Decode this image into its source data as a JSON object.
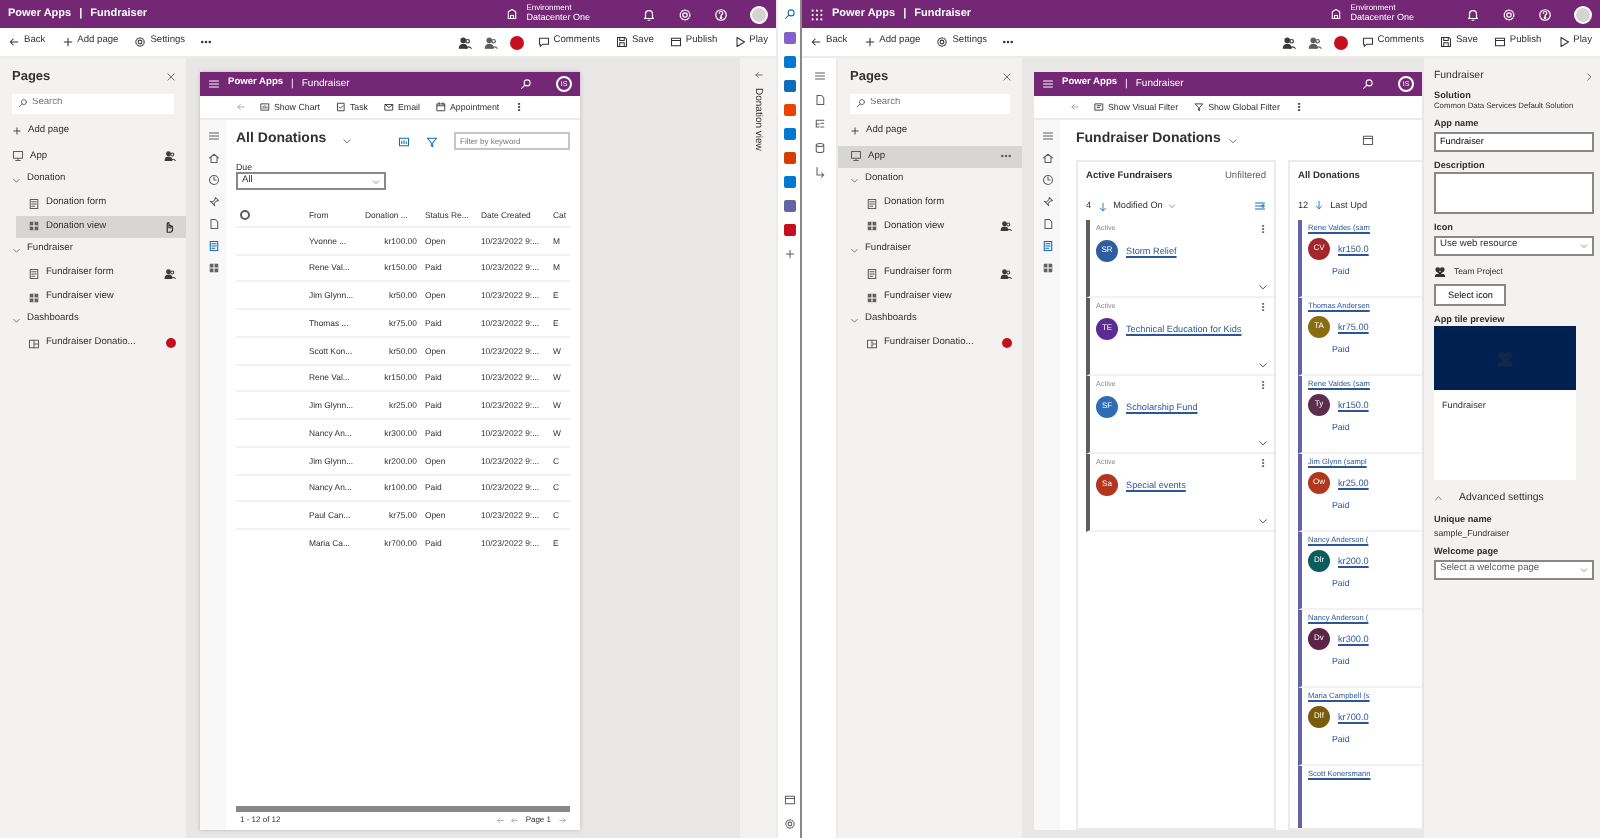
{
  "left_screen": {
    "topbar": {
      "app": "Power Apps",
      "separator": "|",
      "title": "Fundraiser",
      "environment_label": "Environment",
      "environment": "Datacenter One"
    },
    "command_bar": {
      "left": [
        {
          "kind": "back",
          "label": "Back"
        },
        {
          "kind": "add",
          "label": "Add page"
        },
        {
          "kind": "settings",
          "label": "Settings"
        },
        {
          "kind": "more"
        }
      ],
      "right": [
        {
          "kind": "comments",
          "label": "Comments"
        },
        {
          "kind": "save",
          "label": "Save"
        },
        {
          "kind": "publish",
          "label": "Publish"
        },
        {
          "kind": "play",
          "label": "Play"
        }
      ]
    },
    "pages": {
      "title": "Pages",
      "search_placeholder": "Search",
      "add_label": "Add page",
      "tree": [
        {
          "label": "App",
          "kind": "app",
          "selected": false,
          "shared": true
        },
        {
          "label": "Donation",
          "kind": "group",
          "selected": false,
          "expanded": true,
          "children": [
            {
              "label": "Donation form",
              "kind": "form",
              "selected": false
            },
            {
              "label": "Donation view",
              "kind": "view",
              "selected": true,
              "hovered": true
            }
          ]
        },
        {
          "label": "Fundraiser",
          "kind": "group",
          "selected": false,
          "expanded": true,
          "children": [
            {
              "label": "Fundraiser form",
              "kind": "form",
              "selected": false,
              "shared": true
            },
            {
              "label": "Fundraiser view",
              "kind": "view",
              "selected": false
            }
          ]
        },
        {
          "label": "Dashboards",
          "kind": "group",
          "selected": false,
          "expanded": true,
          "children": [
            {
              "label": "Fundraiser Donatio...",
              "kind": "dashboard",
              "selected": false,
              "alert": true
            }
          ]
        }
      ]
    },
    "preview": {
      "header": {
        "app": "Power Apps",
        "title": "Fundraiser",
        "avatar": "IS"
      },
      "select_all_checked": false,
      "commands": [
        {
          "kind": "chart",
          "label": "Show Chart"
        },
        {
          "kind": "task",
          "label": "Task"
        },
        {
          "kind": "email",
          "label": "Email"
        },
        {
          "kind": "appointment",
          "label": "Appointment"
        }
      ],
      "view_title": "All Donations",
      "filter_placeholder": "Filter by keyword",
      "filter_label": "Due",
      "filter_value": "All",
      "columns": [
        "From",
        "Donation ...",
        "Status Re...",
        "Date Created",
        "Cat"
      ],
      "rows": [
        [
          "Yvonne ...",
          "kr100.00",
          "Open",
          "10/23/2022 9:...",
          "M"
        ],
        [
          "Rene Val...",
          "kr150.00",
          "Paid",
          "10/23/2022 9:...",
          "M"
        ],
        [
          "Jim Glynn...",
          "kr50.00",
          "Open",
          "10/23/2022 9:...",
          "E"
        ],
        [
          "Thomas ...",
          "kr75.00",
          "Paid",
          "10/23/2022 9:...",
          "E"
        ],
        [
          "Scott Kon...",
          "kr50.00",
          "Open",
          "10/23/2022 9:...",
          "W"
        ],
        [
          "Rene Val...",
          "kr150.00",
          "Paid",
          "10/23/2022 9:...",
          "W"
        ],
        [
          "Jim Glynn...",
          "kr25.00",
          "Paid",
          "10/23/2022 9:...",
          "W"
        ],
        [
          "Nancy An...",
          "kr300.00",
          "Paid",
          "10/23/2022 9:...",
          "W"
        ],
        [
          "Jim Glynn...",
          "kr200.00",
          "Open",
          "10/23/2022 9:...",
          "C"
        ],
        [
          "Nancy An...",
          "kr100.00",
          "Paid",
          "10/23/2022 9:...",
          "C"
        ],
        [
          "Paul Can...",
          "kr75.00",
          "Open",
          "10/23/2022 9:...",
          "C"
        ],
        [
          "Maria Ca...",
          "kr700.00",
          "Paid",
          "10/23/2022 9:...",
          "E"
        ]
      ],
      "footer": {
        "count": "1 - 12 of 12",
        "page": "Page 1"
      }
    },
    "collapsed_panel": "Donation view"
  },
  "right_screen": {
    "topbar": {
      "app": "Power Apps",
      "separator": "|",
      "title": "Fundraiser",
      "environment_label": "Environment",
      "environment": "Datacenter One"
    },
    "command_bar": {
      "left": [
        {
          "kind": "back",
          "label": "Back"
        },
        {
          "kind": "add",
          "label": "Add page"
        },
        {
          "kind": "settings",
          "label": "Settings"
        },
        {
          "kind": "more"
        }
      ],
      "right": [
        {
          "kind": "comments",
          "label": "Comments"
        },
        {
          "kind": "save",
          "label": "Save"
        },
        {
          "kind": "publish",
          "label": "Publish"
        },
        {
          "kind": "play",
          "label": "Play"
        }
      ]
    },
    "pages": {
      "title": "Pages",
      "search_placeholder": "Search",
      "add_label": "Add page",
      "tree": [
        {
          "label": "App",
          "kind": "app",
          "selected": true,
          "has_menu": true
        },
        {
          "label": "Donation",
          "kind": "group",
          "selected": false,
          "expanded": true,
          "children": [
            {
              "label": "Donation form",
              "kind": "form",
              "selected": false
            },
            {
              "label": "Donation view",
              "kind": "view",
              "selected": false,
              "shared": true
            }
          ]
        },
        {
          "label": "Fundraiser",
          "kind": "group",
          "selected": false,
          "expanded": true,
          "children": [
            {
              "label": "Fundraiser form",
              "kind": "form",
              "selected": false,
              "shared": true
            },
            {
              "label": "Fundraiser view",
              "kind": "view",
              "selected": false
            }
          ]
        },
        {
          "label": "Dashboards",
          "kind": "group",
          "selected": false,
          "expanded": true,
          "children": [
            {
              "label": "Fundraiser Donatio...",
              "kind": "dashboard",
              "selected": false,
              "alert": true
            }
          ]
        }
      ]
    },
    "preview": {
      "header": {
        "app": "Power Apps",
        "title": "Fundraiser",
        "avatar": "IS"
      },
      "commands": [
        {
          "kind": "visual",
          "label": "Show Visual Filter"
        },
        {
          "kind": "filter",
          "label": "Show Global Filter"
        }
      ],
      "title": "Fundraiser Donations",
      "streams": [
        {
          "title": "Active Fundraisers",
          "filter": "Unfiltered",
          "count": "4",
          "sort": "Modified On",
          "cards": [
            {
              "status": "Active",
              "initials": "SR",
              "color": "#2f5d9e",
              "name": "Storm Relief"
            },
            {
              "status": "Active",
              "initials": "TE",
              "color": "#5c2d91",
              "name": "Technical Education for Kids"
            },
            {
              "status": "Active",
              "initials": "SF",
              "color": "#2e6db4",
              "name": "Scholarship Fund"
            },
            {
              "status": "Active",
              "initials": "Sa",
              "color": "#b3341f",
              "name": "Special events"
            }
          ]
        },
        {
          "title": "All Donations",
          "count": "12",
          "sort": "Last Upd",
          "cards": [
            {
              "owner": "Rene Valdes (sam",
              "initials": "CV",
              "color": "#a4262c",
              "amount": "kr150.0",
              "status": "Paid"
            },
            {
              "owner": "Thomas Andersen",
              "initials": "TA",
              "color": "#8a6d0e",
              "amount": "kr75.00",
              "status": "Paid"
            },
            {
              "owner": "Rene Valdes (sam",
              "initials": "Ty",
              "color": "#5c2e4e",
              "amount": "kr150.0",
              "status": "Paid"
            },
            {
              "owner": "Jim Glynn (sampl",
              "initials": "Ow",
              "color": "#b0361c",
              "amount": "kr25.00",
              "status": "Paid"
            },
            {
              "owner": "Nancy Anderson (",
              "initials": "Dlr",
              "color": "#0b5c5c",
              "amount": "kr200.0",
              "status": "Paid"
            },
            {
              "owner": "Nancy Anderson (",
              "initials": "Dv",
              "color": "#5c2446",
              "amount": "kr300.0",
              "status": "Paid"
            },
            {
              "owner": "Maria Campbell (s",
              "initials": "Dlf",
              "color": "#7a5c0a",
              "amount": "kr700.0",
              "status": "Paid"
            },
            {
              "owner": "Scott Konersmann"
            }
          ]
        }
      ]
    },
    "properties": {
      "title": "Fundraiser",
      "solution_label": "Solution",
      "solution": "Common Data Services Default Solution",
      "app_name_label": "App name",
      "app_name": "Fundraiser",
      "description_label": "Description",
      "icon_label": "Icon",
      "icon_value": "Use web resource",
      "icon_name": "Team Project",
      "select_icon": "Select icon",
      "tile_label": "App tile preview",
      "tile_name": "Fundraiser",
      "advanced": "Advanced settings",
      "advanced_expanded": true,
      "unique_label": "Unique name",
      "unique": "sample_Fundraiser",
      "welcome_label": "Welcome page",
      "welcome_placeholder": "Select a welcome page"
    }
  }
}
